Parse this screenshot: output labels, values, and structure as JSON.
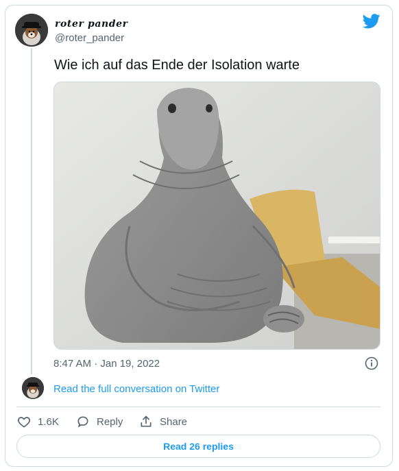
{
  "tweet": {
    "author_name": "roter pander",
    "author_handle": "@roter_pander",
    "text": "Wie ich auf das Ende der Isolation warte",
    "timestamp": "8:47 AM · Jan 19, 2022",
    "media_alt": "gray clay figure sitting with folded hands"
  },
  "links": {
    "read_conversation": "Read the full conversation on Twitter"
  },
  "actions": {
    "like_count": "1.6K",
    "reply_label": "Reply",
    "share_label": "Share",
    "read_replies": "Read 26 replies"
  },
  "colors": {
    "accent": "#1d9bf0",
    "muted": "#536471",
    "border": "#cfd9de",
    "text": "#0f1419"
  },
  "icons": [
    "twitter-bird-icon",
    "info-icon",
    "heart-icon",
    "reply-bubble-icon",
    "share-icon"
  ]
}
